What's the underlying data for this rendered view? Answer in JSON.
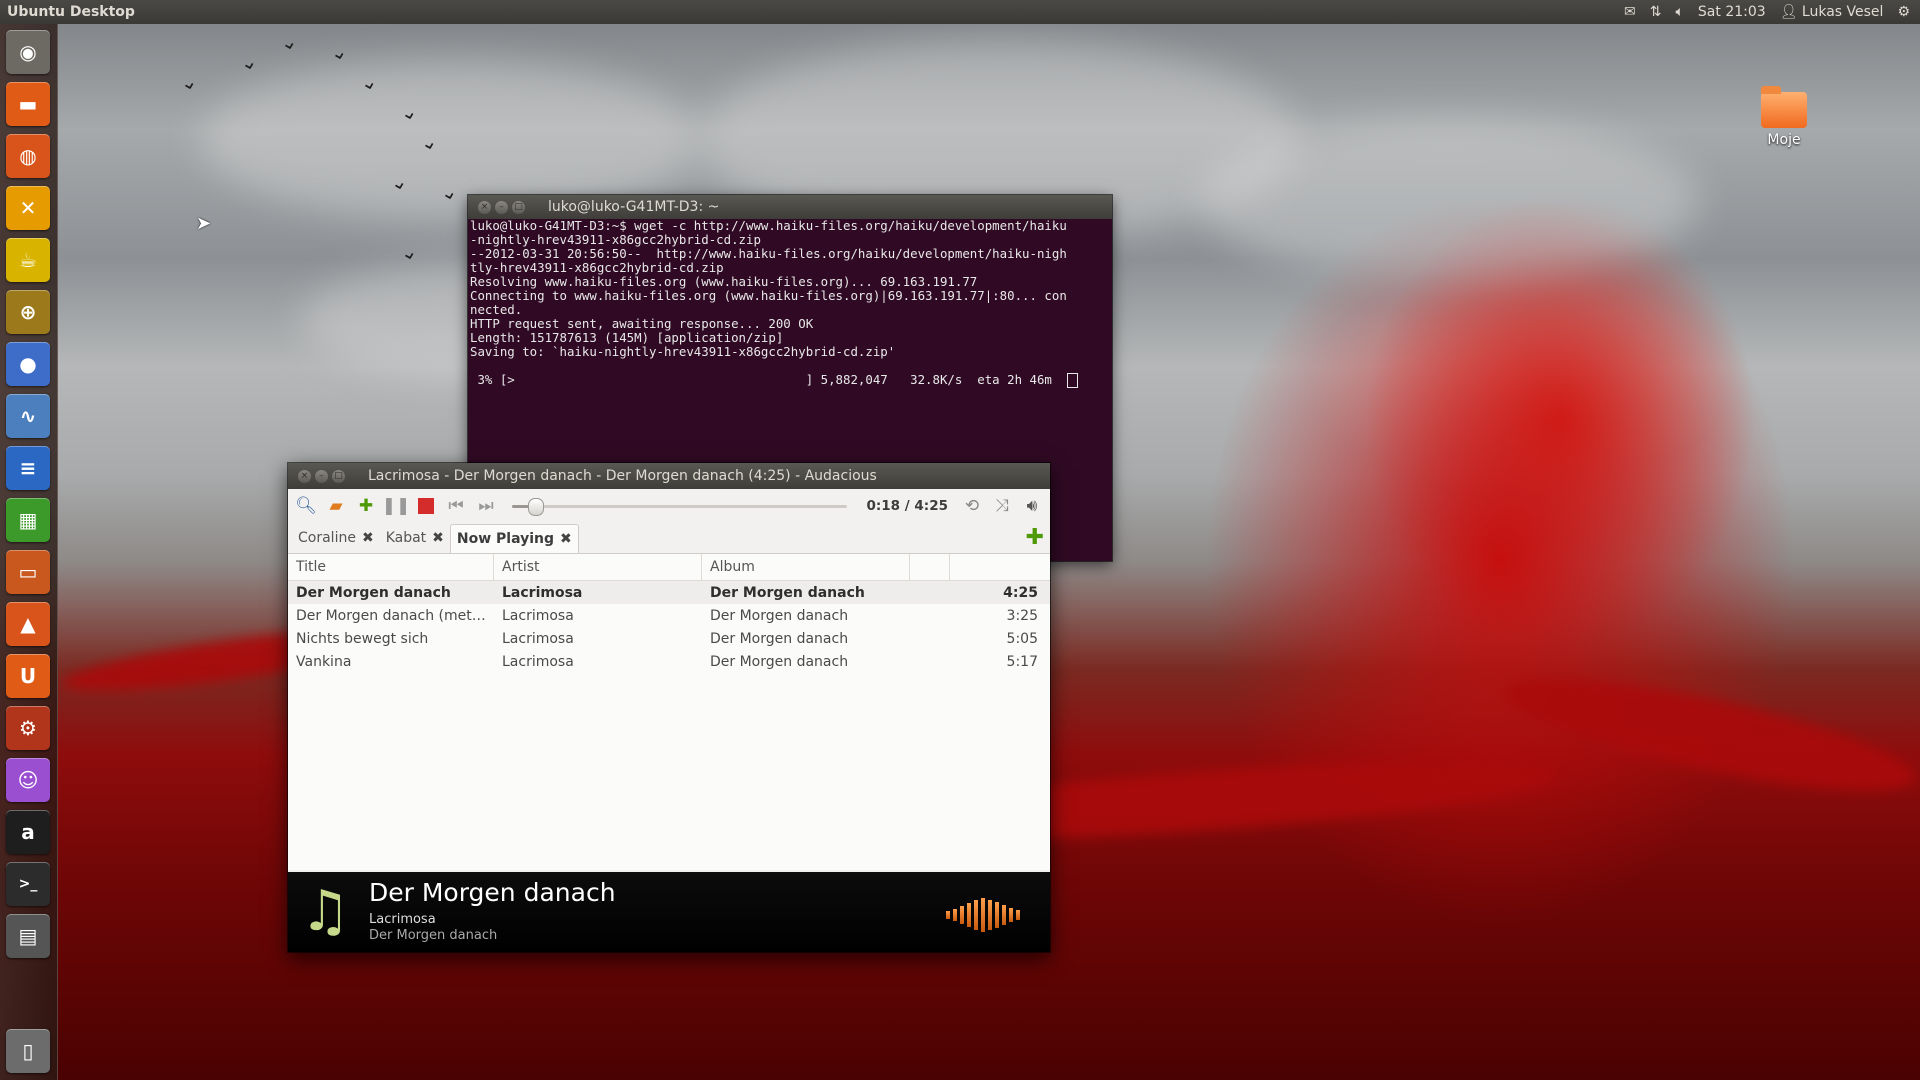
{
  "top_panel": {
    "title": "Ubuntu Desktop",
    "time": "Sat 21:03",
    "user": "Lukas Vesel"
  },
  "desktop": {
    "folder_label": "Moje"
  },
  "launcher": {
    "items": [
      {
        "name": "dash-home",
        "glyph": "◉",
        "color": "#6d6a63"
      },
      {
        "name": "files",
        "glyph": "▬",
        "color": "#e05b16"
      },
      {
        "name": "firefox",
        "glyph": "◍",
        "color": "#d9541a"
      },
      {
        "name": "chat",
        "glyph": "✕",
        "color": "#e69b00"
      },
      {
        "name": "teapot",
        "glyph": "☕",
        "color": "#d8b400"
      },
      {
        "name": "crosshair",
        "glyph": "⊕",
        "color": "#9c7a1b"
      },
      {
        "name": "chat-bubble",
        "glyph": "●",
        "color": "#3d6dc9"
      },
      {
        "name": "system-monitor",
        "glyph": "∿",
        "color": "#4c7fbd"
      },
      {
        "name": "writer",
        "glyph": "≡",
        "color": "#2a68c4"
      },
      {
        "name": "calc",
        "glyph": "▦",
        "color": "#3c9a2a"
      },
      {
        "name": "impress",
        "glyph": "▭",
        "color": "#c8581d"
      },
      {
        "name": "software-center",
        "glyph": "▲",
        "color": "#d9541a"
      },
      {
        "name": "ubuntu-one",
        "glyph": "U",
        "color": "#e05b16"
      },
      {
        "name": "settings",
        "glyph": "⚙",
        "color": "#b0351a"
      },
      {
        "name": "pidgin",
        "glyph": "☺",
        "color": "#9a4fd0"
      },
      {
        "name": "audacious",
        "glyph": "a",
        "color": "#1e1e1e"
      },
      {
        "name": "terminal",
        "glyph": ">_",
        "color": "#2c2c2c"
      },
      {
        "name": "workspaces",
        "glyph": "▤",
        "color": "#555"
      },
      {
        "name": "trash",
        "glyph": "▯",
        "color": "#6c6c6c"
      }
    ]
  },
  "terminal": {
    "title": "luko@luko-G41MT-D3: ~",
    "lines": [
      "luko@luko-G41MT-D3:~$ wget -c http://www.haiku-files.org/haiku/development/haiku",
      "-nightly-hrev43911-x86gcc2hybrid-cd.zip",
      "--2012-03-31 20:56:50--  http://www.haiku-files.org/haiku/development/haiku-nigh",
      "tly-hrev43911-x86gcc2hybrid-cd.zip",
      "Resolving www.haiku-files.org (www.haiku-files.org)... 69.163.191.77",
      "Connecting to www.haiku-files.org (www.haiku-files.org)|69.163.191.77|:80... con",
      "nected.",
      "HTTP request sent, awaiting response... 200 OK",
      "Length: 151787613 (145M) [application/zip]",
      "Saving to: `haiku-nightly-hrev43911-x86gcc2hybrid-cd.zip'",
      "",
      " 3% [>                                       ] 5,882,047   32.8K/s  eta 2h 46m  "
    ]
  },
  "audacious": {
    "title": "Lacrimosa - Der Morgen danach - Der Morgen danach (4:25) - Audacious",
    "time_display": "0:18 / 4:25",
    "progress_fraction": 0.068,
    "tabs": [
      {
        "label": "Coraline",
        "active": false
      },
      {
        "label": "Kabat",
        "active": false
      },
      {
        "label": "Now Playing",
        "active": true
      }
    ],
    "columns": {
      "title": "Title",
      "artist": "Artist",
      "album": "Album"
    },
    "rows": [
      {
        "title": "Der Morgen danach",
        "artist": "Lacrimosa",
        "album": "Der Morgen danach",
        "length": "4:25",
        "current": true
      },
      {
        "title": "Der Morgen danach (metu…",
        "artist": "Lacrimosa",
        "album": "Der Morgen danach",
        "length": "3:25",
        "current": false
      },
      {
        "title": "Nichts bewegt sich",
        "artist": "Lacrimosa",
        "album": "Der Morgen danach",
        "length": "5:05",
        "current": false
      },
      {
        "title": "Vankina",
        "artist": "Lacrimosa",
        "album": "Der Morgen danach",
        "length": "5:17",
        "current": false
      }
    ],
    "infobar": {
      "song": "Der Morgen danach",
      "artist": "Lacrimosa",
      "album": "Der Morgen danach"
    }
  }
}
